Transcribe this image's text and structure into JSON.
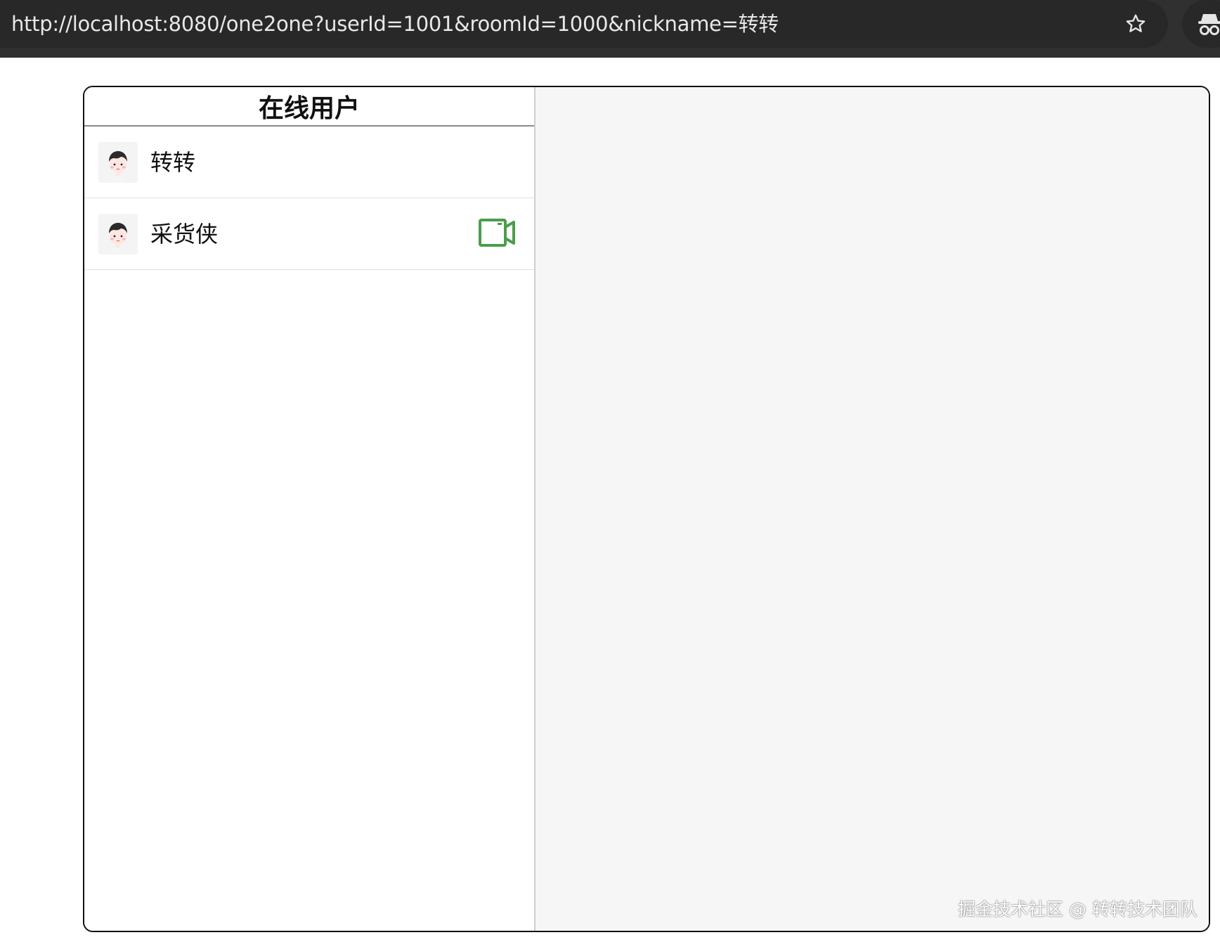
{
  "browser": {
    "url": "http://localhost:8080/one2one?userId=1001&roomId=1000&nickname=转转",
    "bookmark_icon": "star-icon",
    "extension_icon": "incognito-icon"
  },
  "sidebar": {
    "title": "在线用户",
    "users": [
      {
        "name": "转转",
        "avatar_icon": "avatar-icon",
        "show_video": false
      },
      {
        "name": "采货侠",
        "avatar_icon": "avatar-icon",
        "show_video": true
      }
    ],
    "video_icon": "video-camera-icon",
    "video_color": "#4a9e4a"
  },
  "main": {
    "watermark": "掘金技术社区 @ 转转技术团队"
  }
}
